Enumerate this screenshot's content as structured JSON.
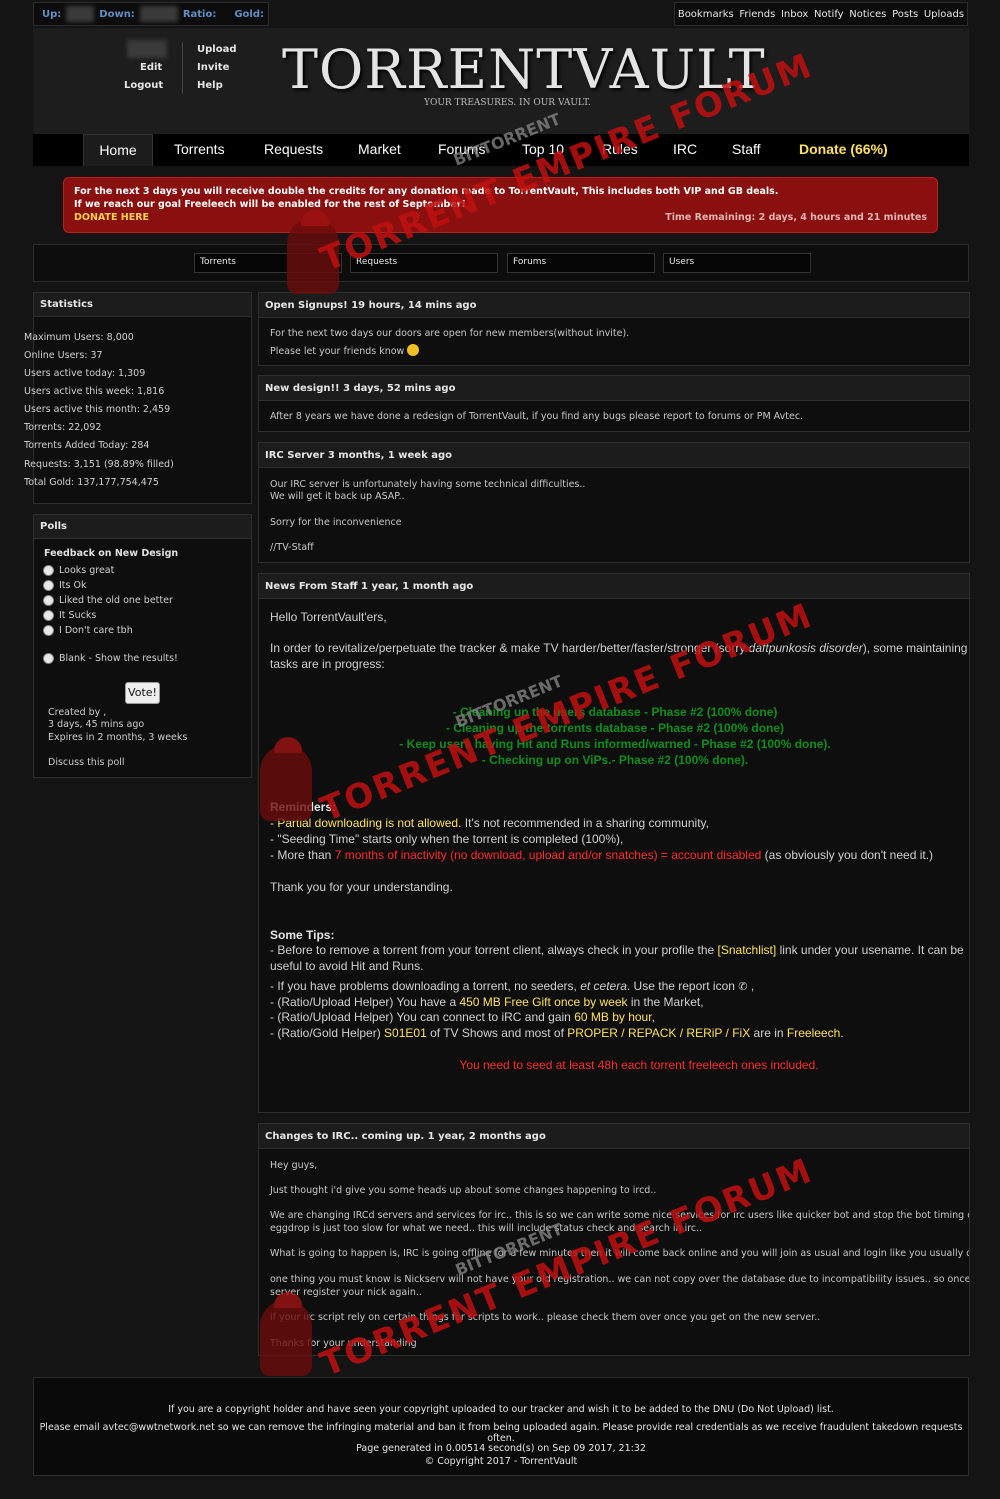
{
  "topbar": {
    "up_label": "Up:",
    "down_label": "Down:",
    "ratio_label": "Ratio:",
    "gold_label": "Gold:",
    "links": [
      "Bookmarks",
      "Friends",
      "Inbox",
      "Notify",
      "Notices",
      "Posts",
      "Uploads"
    ]
  },
  "user_menu": {
    "edit": "Edit",
    "logout": "Logout",
    "upload": "Upload",
    "invite": "Invite",
    "help": "Help"
  },
  "logo": {
    "title": "TORRENTVAULT",
    "tagline": "YOUR TREASURES. IN OUR VAULT."
  },
  "nav": {
    "items": [
      "Home",
      "Torrents",
      "Requests",
      "Market",
      "Forums",
      "Top 10",
      "Rules",
      "IRC",
      "Staff"
    ],
    "donate": "Donate (66%)",
    "active": "Home"
  },
  "banner": {
    "line1": "For the next 3 days you will receive double the credits for any donation made to TorrentVault, This includes both VIP and GB deals.",
    "line2": "If we reach our goal Freeleech will be enabled for the rest of September!",
    "donate_link": "DONATE HERE",
    "time_remaining": "Time Remaining: 2 days, 4 hours and 21 minutes"
  },
  "search": {
    "fields": [
      "Torrents",
      "Requests",
      "Forums",
      "Users"
    ]
  },
  "statistics": {
    "title": "Statistics",
    "lines": [
      "Maximum Users: 8,000",
      "Online Users: 37",
      "Users active today: 1,309",
      "Users active this week: 1,816",
      "Users active this month: 2,459",
      "Torrents: 22,092",
      "Torrents Added Today: 284",
      "Requests: 3,151 (98.89% filled)",
      "Total Gold: 137,177,754,475"
    ]
  },
  "poll": {
    "title": "Polls",
    "question": "Feedback on New Design",
    "options": [
      "Looks great",
      "Its Ok",
      "Liked the old one better",
      "It Sucks",
      "I Don't care tbh"
    ],
    "blank": "Blank - Show the results!",
    "vote": "Vote!",
    "created_by": "Created by ,",
    "created_ago": "3 days, 45 mins ago",
    "expires": "Expires in 2 months, 3 weeks",
    "discuss": "Discuss this poll"
  },
  "posts": {
    "p1": {
      "title": "Open Signups! 19 hours, 14 mins ago",
      "l1": "For the next two days our doors are open for new members(without invite).",
      "l2": "Please let your friends know"
    },
    "p2": {
      "title": "New design!! 3 days, 52 mins ago",
      "l1": "After 8 years we have done a redesign of TorrentVault, if you find any bugs please report to forums or PM Avtec."
    },
    "p3": {
      "title": "IRC Server 3 months, 1 week ago",
      "l1": "Our IRC server is unfortunately having some technical difficulties..",
      "l2": "We will get it back up ASAP..",
      "l3": "Sorry for the inconvenience",
      "l4": "//TV-Staff"
    },
    "p4": {
      "title": "News From Staff 1 year, 1 month ago",
      "hello": "Hello TorrentVault'ers,",
      "intro1": "In order to revitalize/perpetuate the tracker & make TV harder/better/faster/stronger (sorry ",
      "intro_em": "daftpunkosis disorder",
      "intro2": "), some maintaining",
      "intro3": "tasks are in progress:",
      "tasks": [
        "- Cleaning up the users database - Phase #2 (100% done)",
        "- Cleaning up the torrents database - Phase #2 (100% done)",
        "- Keep users having Hit and Runs informed/warned - Phase #2 (100% done).",
        "- Checking up on ViPs.- Phase #2 (100% done)."
      ],
      "reminders_title": "Reminders:",
      "r1_hl": "- Partial downloading is not allowed.",
      "r1_rest": " It's not recommended in a sharing community,",
      "r2": "- \"Seeding Time\" starts only when the torrent is completed (100%),",
      "r3_a": "- More than ",
      "r3_red": "7 months of inactivity (no download, upload and/or snatches) = account disabled",
      "r3_b": " (as obviously you don't need it.)",
      "thanks": "Thank you for your understanding.",
      "tips_title": "Some Tips:",
      "t1_a": "- Before to remove a torrent from your torrent client, always check in your profile the ",
      "t1_link": "[Snatchlist]",
      "t1_b": " link under your usename. It can be",
      "t1_c": "useful to avoid Hit and Runs.",
      "t2_a": "- If you have problems downloading a torrent, no seeders, ",
      "t2_em": "et cetera",
      "t2_b": ". Use the report icon",
      "t2_c": " ,",
      "t3_a": "- (Ratio/Upload Helper) You have a ",
      "t3_hl": "450 MB Free Gift once by week",
      "t3_b": " in the Market,",
      "t4_a": "- (Ratio/Upload Helper) You can connect to iRC and gain ",
      "t4_hl": "60 MB by hour",
      "t4_b": ",",
      "t5_a": "- (Ratio/Gold Helper) ",
      "t5_hl1": "S01E01",
      "t5_b": " of TV Shows and most of ",
      "t5_hl2": "PROPER / REPACK / RERiP / FiX",
      "t5_c": " are in ",
      "t5_hl3": "Freeleech",
      "t5_d": ".",
      "seed_note": "You need to seed at least 48h each torrent freeleech ones included."
    },
    "p5": {
      "title": "Changes to IRC.. coming up. 1 year, 2 months ago",
      "l1": "Hey guys,",
      "l2": "Just thought i'd give you some heads up about some changes happening to ircd..",
      "l3": "We are changing IRCd servers and services for irc.. this is so we can write some nice services for irc users like quicker bot and stop the bot timing out with mysql",
      "l4": "eggdrop is just too slow for what we need.. this will include status check and search in irc..",
      "l5": "What is going to happen is, IRC is going offline for a few minutes then it will come back online and you will join as usual and login like you usually do..",
      "l6": "one thing you must know is Nickserv will not have your old registration.. we can not copy over the database due to incompatibility issues.. so once you get on th",
      "l7": "server register your nick again..",
      "l8": "if your irc script rely on certain things for scripts to work.. please check them over once you get on the new server..",
      "l9": "Thanks for your understanding"
    }
  },
  "footer": {
    "l1": "If you are a copyright holder and have seen your copyright uploaded to our tracker and wish it to be added to the DNU (Do Not Upload) list.",
    "l2": "Please email avtec@wwtnetwork.net so we can remove the infringing material and ban it from being uploaded again. Please provide real credentials as we receive fraudulent takedown requests often.",
    "l3": "Page generated in 0.00514 second(s) on Sep 09 2017, 21:32",
    "l4": "© Copyright 2017 - TorrentVault"
  },
  "watermark": {
    "top": "BITTORRENT",
    "main": "TORRENT EMPIRE FORUM"
  },
  "colors": {
    "accent_blue": "#5f8fc4",
    "banner_red": "#8a0f0f",
    "donate_yellow": "#ffe066",
    "progress_green": "#0c8f1a",
    "warning_red": "#ff2a2a"
  }
}
